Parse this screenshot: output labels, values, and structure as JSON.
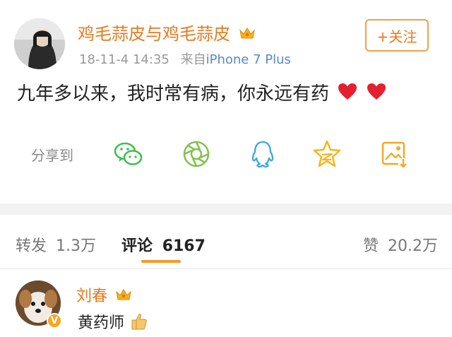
{
  "post": {
    "author": "鸡毛蒜皮与鸡毛蒜皮",
    "timestamp": "18-11-4 14:35",
    "source_prefix": "来自",
    "source": "iPhone 7 Plus",
    "follow_label": "+关注",
    "content": "九年多以来，我时常有病，你永远有药",
    "share_label": "分享到",
    "share_targets": [
      "wechat-icon",
      "moments-icon",
      "qq-icon",
      "qzone-icon",
      "save-image-icon"
    ]
  },
  "tabs": {
    "repost_label": "转发",
    "repost_count": "1.3万",
    "comments_label": "评论",
    "comments_count": "6167",
    "likes_label": "赞",
    "likes_count": "20.2万"
  },
  "comment": {
    "author": "刘春",
    "text": "黄药师"
  },
  "colors": {
    "accent": "#e8791f",
    "link": "#5b8ac7",
    "indicator": "#f59a23",
    "wechat": "#3cbf4c",
    "qq": "#3ba7e0",
    "qzone": "#f6b51a"
  }
}
